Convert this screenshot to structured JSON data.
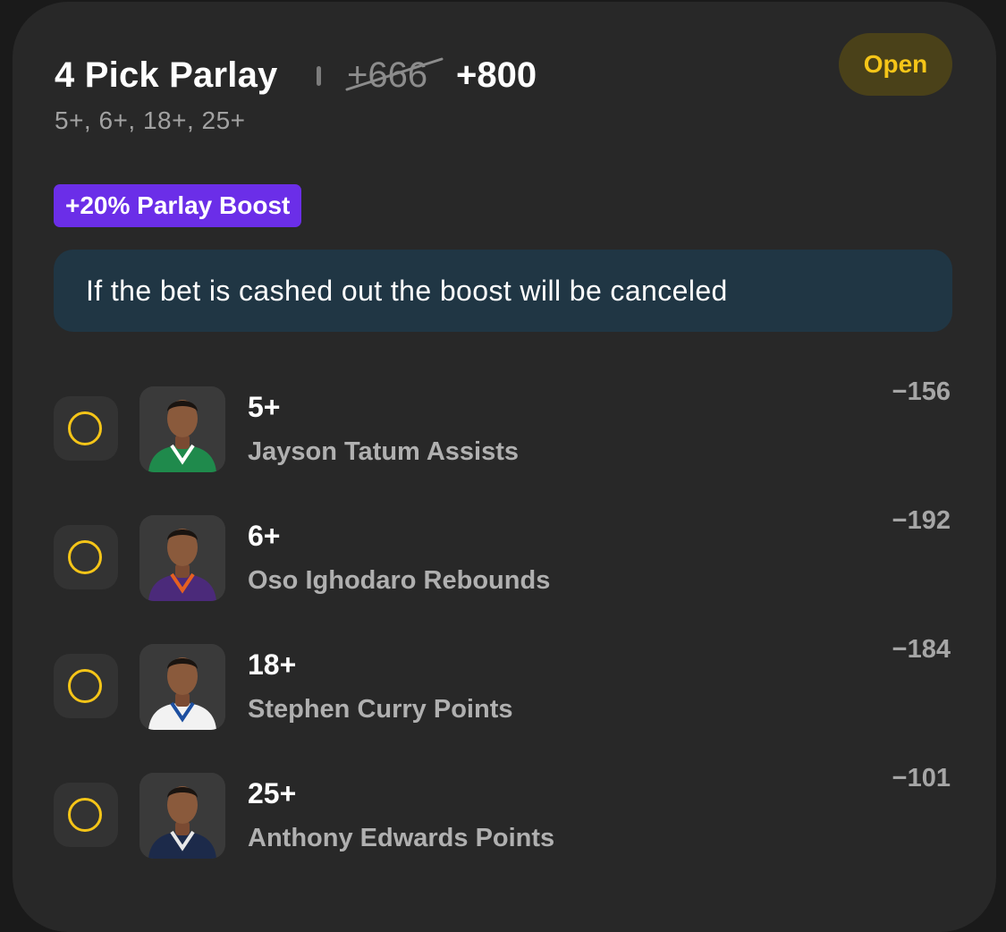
{
  "parlay": {
    "title": "4 Pick Parlay",
    "old_odds": "+666",
    "new_odds": "+800",
    "subtitle": "5+, 6+, 18+, 25+",
    "status": "Open",
    "boost_badge": "+20% Parlay Boost",
    "notice": "If the bet is cashed out the boost will be canceled"
  },
  "legs": [
    {
      "line": "5+",
      "player": "Jayson Tatum Assists",
      "price": "−156",
      "jersey": "#1f8a4c",
      "trim": "#ffffff"
    },
    {
      "line": "6+",
      "player": "Oso Ighodaro Rebounds",
      "price": "−192",
      "jersey": "#4b2a7a",
      "trim": "#e56020"
    },
    {
      "line": "18+",
      "player": "Stephen Curry Points",
      "price": "−184",
      "jersey": "#f2f2f2",
      "trim": "#1d4fa0"
    },
    {
      "line": "25+",
      "player": "Anthony Edwards Points",
      "price": "−101",
      "jersey": "#1c2a4a",
      "trim": "#e8e8e8"
    }
  ],
  "colors": {
    "accent_yellow": "#f5c518",
    "boost_purple": "#6b2ee8",
    "notice_bg": "#203644",
    "card_bg": "#282828"
  },
  "icons": {
    "check": "circle-outline-icon",
    "avatar": "player-headshot"
  }
}
